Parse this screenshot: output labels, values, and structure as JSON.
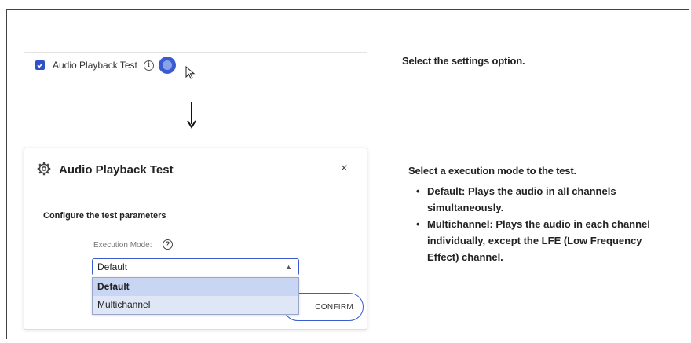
{
  "step1": {
    "checkbox_label": "Audio Playback Test",
    "info_icon": "i",
    "instruction": "Select the settings option."
  },
  "dialog": {
    "title": "Audio Playback Test",
    "close": "×",
    "subtitle": "Configure the test parameters",
    "mode_label": "Execution Mode:",
    "help_icon": "?",
    "selected_value": "Default",
    "options": [
      "Default",
      "Multichannel"
    ],
    "confirm_label": "CONFIRM"
  },
  "step2": {
    "instruction": "Select a execution mode to the test.",
    "bullets": [
      "Default: Plays the audio in all channels simultaneously.",
      "Multichannel: Plays the audio in each channel individually, except the LFE (Low Frequency Effect) channel."
    ]
  },
  "colors": {
    "accent": "#3a5cd0",
    "dropdown_bg": "#dfe7f7"
  }
}
